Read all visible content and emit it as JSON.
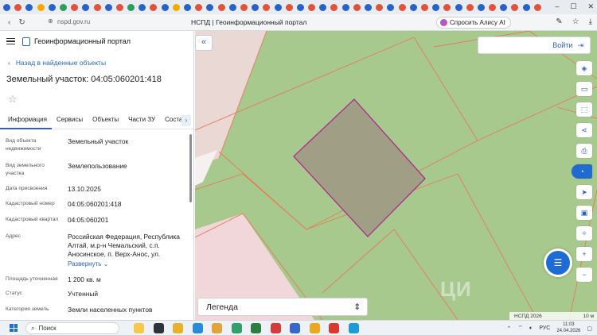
{
  "browser": {
    "url": "nspd.gov.ru",
    "page_title": "НСПД | Геоинформационный портал",
    "alisa_label": "Спросить Алису AI",
    "tab_favicon_colors": [
      "#2563c9",
      "#e0523a",
      "#2563c9",
      "#f2a900",
      "#2563c9",
      "#2a9d5c",
      "#e0523a",
      "#2563c9",
      "#e0523a",
      "#2563c9",
      "#e0523a",
      "#2a9d5c",
      "#2563c9",
      "#e0523a",
      "#2563c9",
      "#f2a900",
      "#2563c9",
      "#e0523a",
      "#2563c9",
      "#e0523a",
      "#2563c9",
      "#e0523a",
      "#2563c9",
      "#e0523a",
      "#2563c9",
      "#e0523a",
      "#2563c9",
      "#e0523a",
      "#2563c9",
      "#e0523a",
      "#2563c9",
      "#e0523a",
      "#2563c9",
      "#e0523a",
      "#2563c9",
      "#e0523a",
      "#2563c9",
      "#e0523a",
      "#2563c9",
      "#e0523a",
      "#2563c9",
      "#e0523a",
      "#2563c9",
      "#e0523a",
      "#2563c9",
      "#e0523a",
      "#2563c9",
      "#e0523a"
    ]
  },
  "panel": {
    "portal_name": "Геоинформационный портал",
    "back_label": "Назад в найденные объекты",
    "title": "Земельный участок: 04:05:060201:418",
    "tabs": [
      "Информация",
      "Сервисы",
      "Объекты",
      "Части ЗУ",
      "Состав"
    ],
    "rows": [
      {
        "key": "Вид объекта недвижимости",
        "value": "Земельный участок"
      },
      {
        "key": "Вид земельного участка",
        "value": "Землепользование"
      },
      {
        "key": "Дата присвоения",
        "value": "13.10.2025"
      },
      {
        "key": "Кадастровый номер",
        "value": "04:05:060201:418"
      },
      {
        "key": "Кадастровый квартал",
        "value": "04:05:060201"
      },
      {
        "key": "Адрес",
        "value": "Российская Федерация, Республика Алтай, м.р-н Чемальский, с.п. Аносинское, п. Верх-Анос, ул."
      },
      {
        "key": "",
        "value": "Развернуть"
      },
      {
        "key": "Площадь уточненная",
        "value": "1 200 кв. м"
      },
      {
        "key": "Статус",
        "value": "Учтенный"
      },
      {
        "key": "Категория земель",
        "value": "Земли населенных пунктов"
      }
    ]
  },
  "map": {
    "login_label": "Войти",
    "legend_label": "Легенда",
    "attribution": "НСПД 2026",
    "scale_label": "10 м",
    "watermark": "ЦИ",
    "colors": {
      "background": "#a8c98d",
      "selected_fill": "#a09f85",
      "selected_stroke": "#b0208f",
      "parcel_stroke": "#e67a5a",
      "pink_zone": "#efd9dc"
    }
  },
  "taskbar": {
    "search_placeholder": "Поиск",
    "lang": "РУС",
    "time": "11:03",
    "date": "24.04.2026"
  }
}
